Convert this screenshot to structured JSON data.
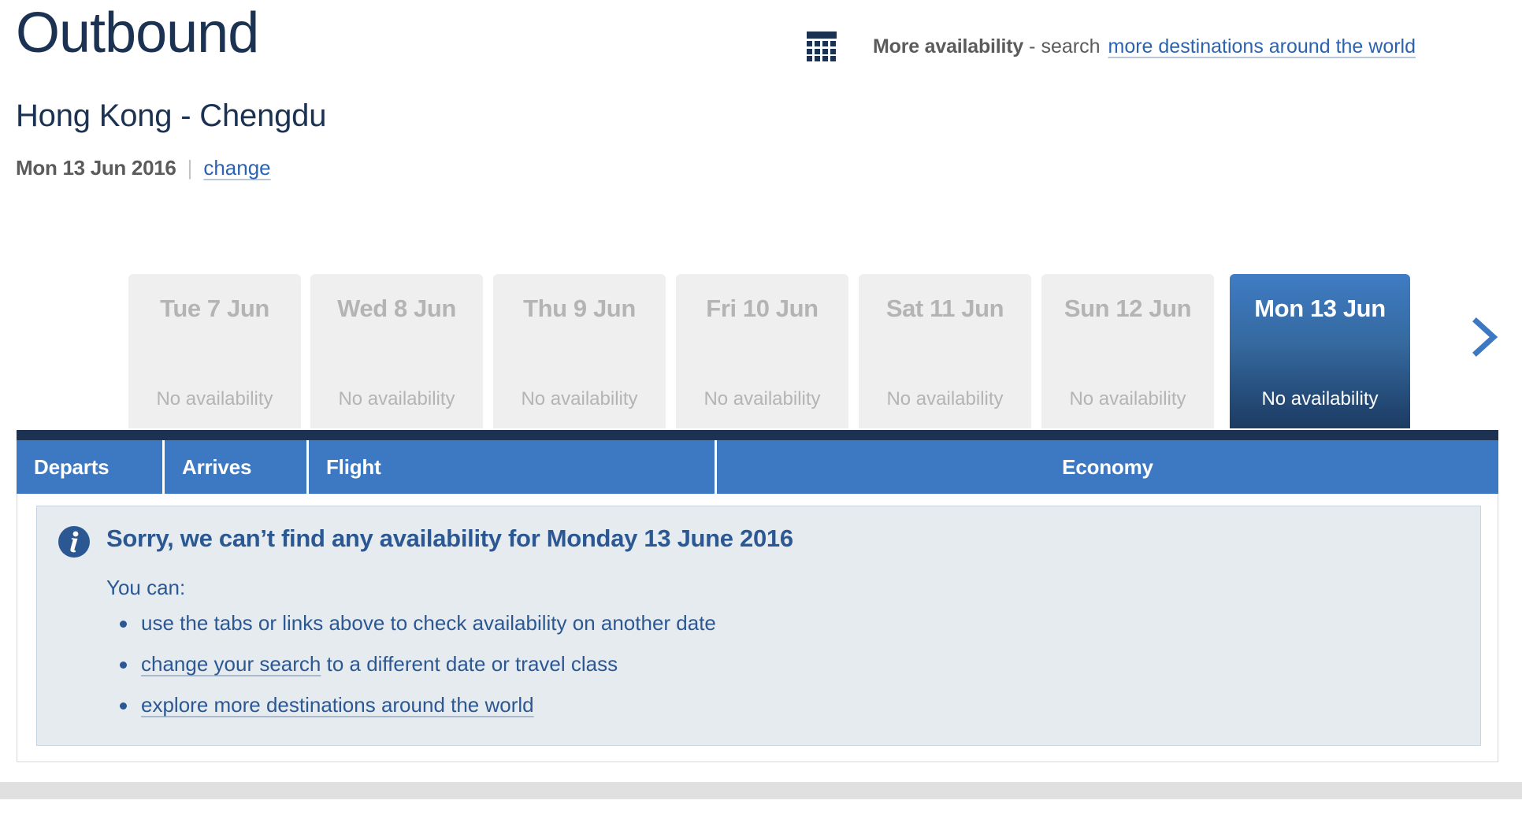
{
  "header": {
    "title": "Outbound",
    "route": "Hong Kong - Chengdu",
    "date": "Mon 13 Jun 2016",
    "separator": "|",
    "change_label": "change"
  },
  "more_availability": {
    "icon": "calendar-grid-icon",
    "strong_label": "More availability",
    "dash": "-",
    "plain_label": "search",
    "link_label": "more destinations around the world"
  },
  "date_tabs": {
    "status_default": "No availability",
    "items": [
      {
        "label": "Tue 7 Jun",
        "status": "No availability",
        "selected": false
      },
      {
        "label": "Wed 8 Jun",
        "status": "No availability",
        "selected": false
      },
      {
        "label": "Thu 9 Jun",
        "status": "No availability",
        "selected": false
      },
      {
        "label": "Fri 10 Jun",
        "status": "No availability",
        "selected": false
      },
      {
        "label": "Sat 11 Jun",
        "status": "No availability",
        "selected": false
      },
      {
        "label": "Sun 12 Jun",
        "status": "No availability",
        "selected": false
      },
      {
        "label": "Mon 13 Jun",
        "status": "No availability",
        "selected": true
      }
    ],
    "next_arrow": "chevron-right-icon"
  },
  "results_table": {
    "columns": {
      "departs": "Departs",
      "arrives": "Arrives",
      "flight": "Flight",
      "economy": "Economy"
    }
  },
  "info_message": {
    "icon": "info-circle-icon",
    "title": "Sorry, we can’t find any availability for Monday 13 June 2016",
    "intro": "You can:",
    "bullets": [
      {
        "prefix": "",
        "link": "",
        "suffix": "use the tabs or links above to check availability on another date"
      },
      {
        "prefix": "",
        "link": "change your search",
        "suffix": " to a different date or travel class"
      },
      {
        "prefix": "",
        "link": "explore more destinations around the world",
        "suffix": ""
      }
    ]
  },
  "colors": {
    "navy": "#1c3252",
    "header_blue": "#3d79c2",
    "link_blue": "#2b63b0",
    "info_bg": "#e6ebf0",
    "info_text": "#2b5893",
    "tab_inactive_bg": "#efefef",
    "tab_inactive_text": "#b4b4b4",
    "footer_bar": "#e0e0e0"
  }
}
